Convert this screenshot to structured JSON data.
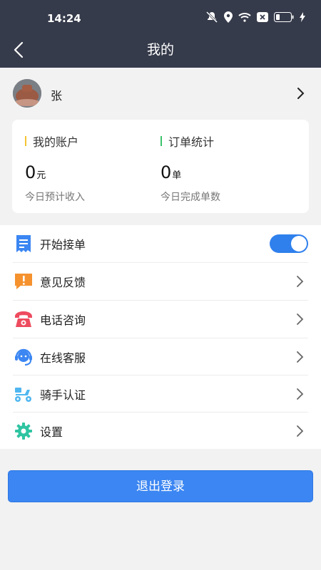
{
  "status_bar": {
    "time": "14:24"
  },
  "header": {
    "title": "我的"
  },
  "profile": {
    "name": "张"
  },
  "account": {
    "title": "我的账户",
    "value": "0",
    "unit": "元",
    "caption": "今日预计收入",
    "accent": "#f4c430"
  },
  "orders": {
    "title": "订单统计",
    "value": "0",
    "unit": "单",
    "caption": "今日完成单数",
    "accent": "#3cc36b"
  },
  "menu": {
    "items": [
      {
        "label": "开始接单",
        "icon": "receipt-icon",
        "toggle_on": true
      },
      {
        "label": "意见反馈",
        "icon": "feedback-icon"
      },
      {
        "label": "电话咨询",
        "icon": "phone-icon"
      },
      {
        "label": "在线客服",
        "icon": "headset-icon"
      },
      {
        "label": "骑手认证",
        "icon": "scooter-icon"
      },
      {
        "label": "设置",
        "icon": "gear-icon"
      }
    ]
  },
  "logout": {
    "label": "退出登录"
  },
  "colors": {
    "header_bg": "#363b4b",
    "primary": "#3b86f2"
  }
}
